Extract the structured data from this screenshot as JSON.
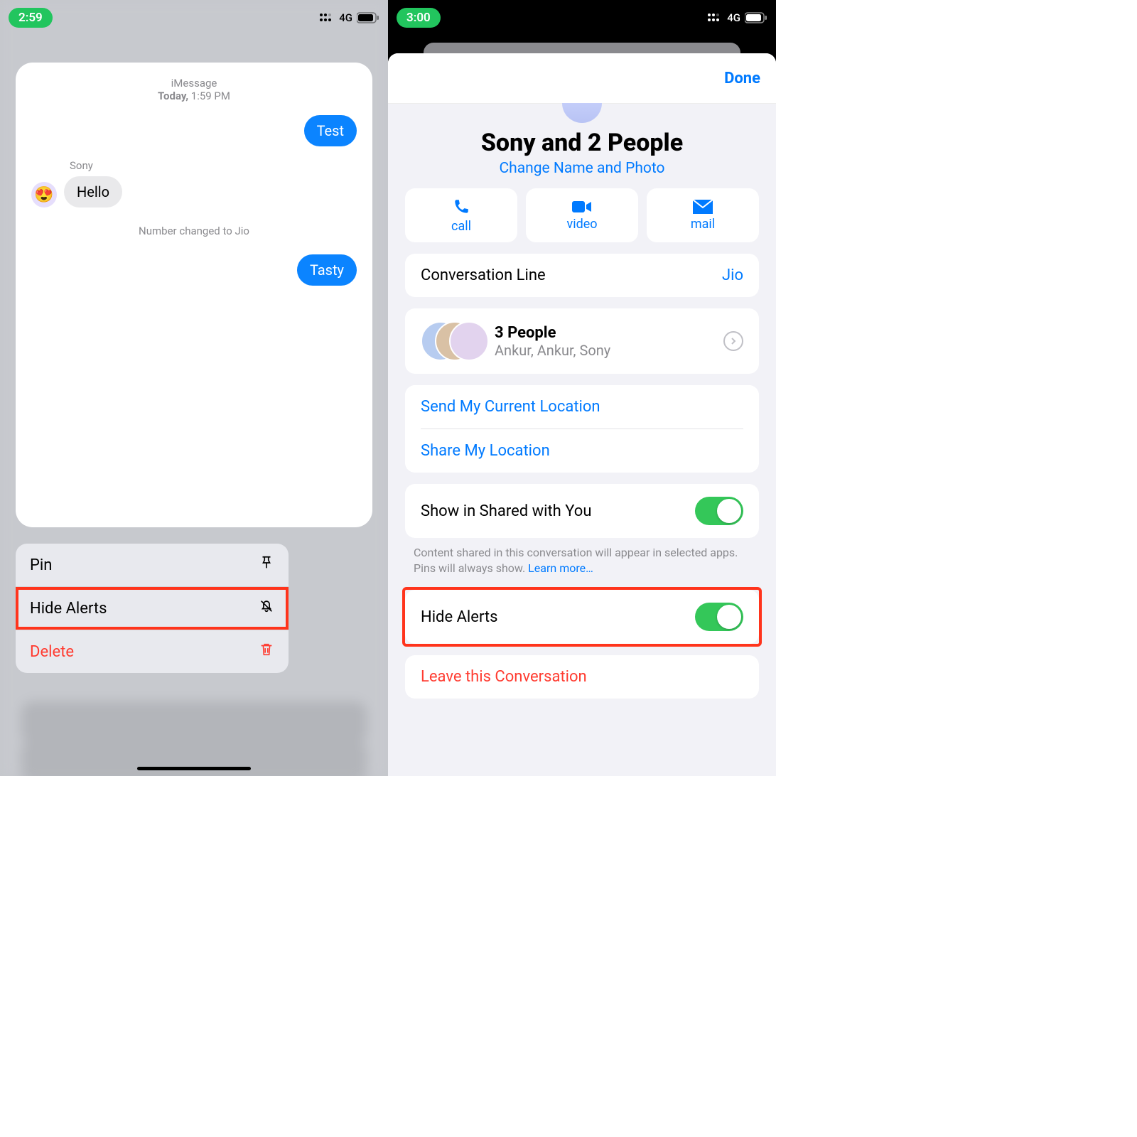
{
  "left": {
    "time": "2:59",
    "network": "4G",
    "chat": {
      "meta_line1": "iMessage",
      "meta_day": "Today,",
      "meta_timestamp": "1:59 PM",
      "msg_out1": "Test",
      "msg_in_sender": "Sony",
      "msg_in1": "Hello",
      "system": "Number changed to Jio",
      "msg_out2": "Tasty"
    },
    "menu": {
      "pin": "Pin",
      "hide_alerts": "Hide Alerts",
      "delete": "Delete"
    }
  },
  "right": {
    "time": "3:00",
    "network": "4G",
    "done": "Done",
    "title": "Sony and 2 People",
    "subtitle": "Change Name and Photo",
    "actions": {
      "call": "call",
      "video": "video",
      "mail": "mail"
    },
    "conv_line_label": "Conversation Line",
    "conv_line_value": "Jio",
    "people_title": "3 People",
    "people_names": "Ankur, Ankur, Sony",
    "send_loc": "Send My Current Location",
    "share_loc": "Share My Location",
    "shared_with_you": "Show in Shared with You",
    "footnote_text": "Content shared in this conversation will appear in selected apps. Pins will always show. ",
    "footnote_link": "Learn more…",
    "hide_alerts": "Hide Alerts",
    "leave": "Leave this Conversation"
  }
}
